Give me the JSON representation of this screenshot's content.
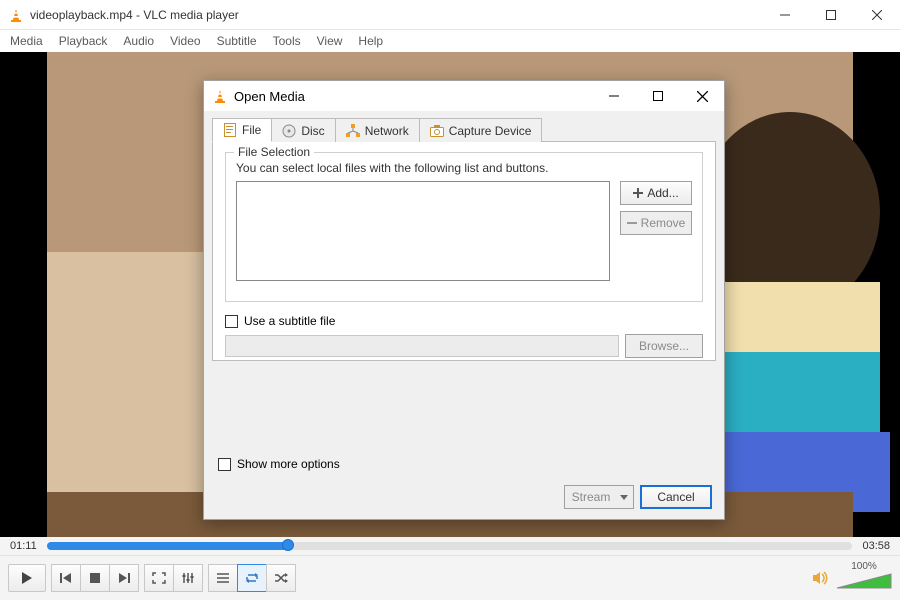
{
  "titlebar": {
    "title": "videoplayback.mp4 - VLC media player"
  },
  "menubar": [
    "Media",
    "Playback",
    "Audio",
    "Video",
    "Subtitle",
    "Tools",
    "View",
    "Help"
  ],
  "player": {
    "current_time": "01:11",
    "total_time": "03:58",
    "progress_percent": 30,
    "volume_percent": "100%",
    "volume_value": 100
  },
  "dialog": {
    "title": "Open Media",
    "tabs": [
      {
        "label": "File",
        "icon": "file-icon"
      },
      {
        "label": "Disc",
        "icon": "disc-icon"
      },
      {
        "label": "Network",
        "icon": "network-icon"
      },
      {
        "label": "Capture Device",
        "icon": "capture-icon"
      }
    ],
    "active_tab": 0,
    "file_section": {
      "legend": "File Selection",
      "hint": "You can select local files with the following list and buttons.",
      "add_label": "Add...",
      "remove_label": "Remove"
    },
    "subtitle": {
      "checkbox_label": "Use a subtitle file",
      "browse_label": "Browse..."
    },
    "more_options_label": "Show more options",
    "footer": {
      "stream_label": "Stream",
      "cancel_label": "Cancel"
    }
  }
}
